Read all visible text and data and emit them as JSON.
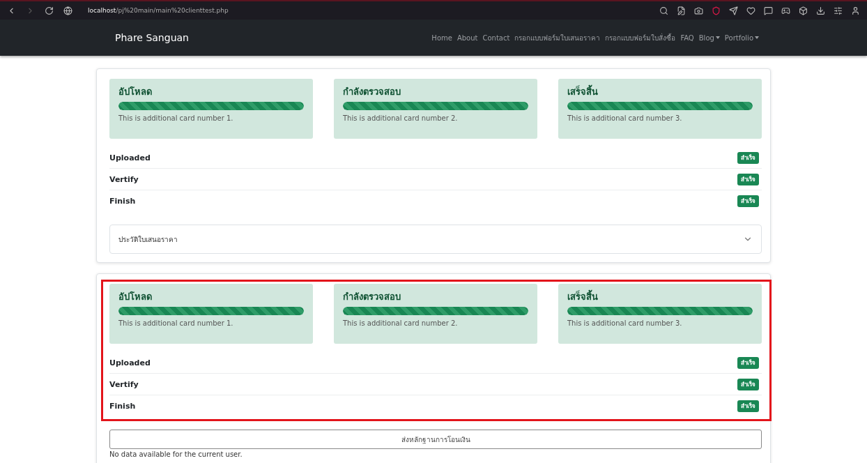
{
  "browser": {
    "url_host": "localhost",
    "url_path": "/pj%20main/main%20clienttest.php"
  },
  "navbar": {
    "brand": "Phare Sanguan",
    "links": [
      {
        "label": "Home",
        "dropdown": false
      },
      {
        "label": "About",
        "dropdown": false
      },
      {
        "label": "Contact",
        "dropdown": false
      },
      {
        "label": "กรอกแบบฟอร์มใบเสนอราคา",
        "dropdown": false
      },
      {
        "label": "กรอกแบบฟอร์มใบสั่งซื้อ",
        "dropdown": false
      },
      {
        "label": "FAQ",
        "dropdown": false
      },
      {
        "label": "Blog",
        "dropdown": true
      },
      {
        "label": "Portfolio",
        "dropdown": true
      }
    ]
  },
  "sections": [
    {
      "highlighted": false,
      "stages": [
        {
          "title": "อัปโหลด",
          "level": 1,
          "text": "This is additional card number 1."
        },
        {
          "title": "กำลังตรวจสอบ",
          "level": 1,
          "text": "This is additional card number 2."
        },
        {
          "title": "เสร็จสิ้น",
          "level": 1,
          "text": "This is additional card number 3."
        }
      ],
      "steps": [
        {
          "label": "Uploaded",
          "badge": "สำเร็จ"
        },
        {
          "label": "Vertify",
          "badge": "สำเร็จ"
        },
        {
          "label": "Finish",
          "badge": "สำเร็จ"
        }
      ],
      "accordion": {
        "title": "ประวัติใบเสนอราคา",
        "expanded": false
      }
    },
    {
      "highlighted": true,
      "stages": [
        {
          "title": "อัปโหลด",
          "level": 1,
          "text": "This is additional card number 1."
        },
        {
          "title": "กำลังตรวจสอบ",
          "level": 1,
          "text": "This is additional card number 2."
        },
        {
          "title": "เสร็จสิ้น",
          "level": 1,
          "text": "This is additional card number 3."
        }
      ],
      "steps": [
        {
          "label": "Uploaded",
          "badge": "สำเร็จ"
        },
        {
          "label": "Vertify",
          "badge": "สำเร็จ"
        },
        {
          "label": "Finish",
          "badge": "สำเร็จ"
        }
      ],
      "button": "ส่งหลักฐานการโอนเงิน",
      "note": "No data available for the current user."
    }
  ]
}
